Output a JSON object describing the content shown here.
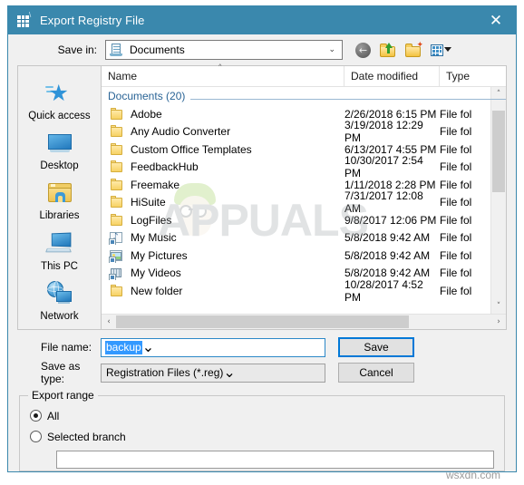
{
  "window": {
    "title": "Export Registry File",
    "icon": "registry-editor-icon",
    "close_label": "✕",
    "titlebar_color": "#3a88ad"
  },
  "toolbar": {
    "savein_label": "Save in:",
    "savein_value": "Documents",
    "savein_icon": "documents-folder-icon",
    "dropdown_caret": "⌄",
    "buttons": [
      {
        "name": "back-button",
        "icon": "back-arrow-icon",
        "glyph": "←"
      },
      {
        "name": "up-one-level-button",
        "icon": "up-folder-icon"
      },
      {
        "name": "create-new-folder-button",
        "icon": "new-folder-icon"
      },
      {
        "name": "views-button",
        "icon": "views-grid-icon",
        "caret": "▾"
      }
    ]
  },
  "places": {
    "items": [
      {
        "label": "Quick access",
        "icon": "quick-access-star-icon"
      },
      {
        "label": "Desktop",
        "icon": "desktop-monitor-icon"
      },
      {
        "label": "Libraries",
        "icon": "libraries-folder-icon"
      },
      {
        "label": "This PC",
        "icon": "this-pc-computer-icon"
      },
      {
        "label": "Network",
        "icon": "network-globe-icon"
      }
    ]
  },
  "file_list": {
    "columns": [
      {
        "key": "name",
        "label": "Name",
        "sorted": true,
        "sort_caret": "˄"
      },
      {
        "key": "date",
        "label": "Date modified"
      },
      {
        "key": "type",
        "label": "Type"
      }
    ],
    "group_header": "Documents (20)",
    "rows": [
      {
        "name": "Adobe",
        "date": "2/26/2018 6:15 PM",
        "type": "File fol",
        "icon": "folder-icon"
      },
      {
        "name": "Any Audio Converter",
        "date": "3/19/2018 12:29 PM",
        "type": "File fol",
        "icon": "folder-icon"
      },
      {
        "name": "Custom Office Templates",
        "date": "6/13/2017 4:55 PM",
        "type": "File fol",
        "icon": "folder-icon"
      },
      {
        "name": "FeedbackHub",
        "date": "10/30/2017 2:54 PM",
        "type": "File fol",
        "icon": "folder-icon"
      },
      {
        "name": "Freemake",
        "date": "1/11/2018 2:28 PM",
        "type": "File fol",
        "icon": "folder-icon"
      },
      {
        "name": "HiSuite",
        "date": "7/31/2017 12:08 AM",
        "type": "File fol",
        "icon": "folder-icon"
      },
      {
        "name": "LogFiles",
        "date": "9/8/2017 12:06 PM",
        "type": "File fol",
        "icon": "folder-icon"
      },
      {
        "name": "My Music",
        "date": "5/8/2018 9:42 AM",
        "type": "File fol",
        "icon": "music-folder-icon"
      },
      {
        "name": "My Pictures",
        "date": "5/8/2018 9:42 AM",
        "type": "File fol",
        "icon": "pictures-folder-icon"
      },
      {
        "name": "My Videos",
        "date": "5/8/2018 9:42 AM",
        "type": "File fol",
        "icon": "videos-folder-icon"
      },
      {
        "name": "New folder",
        "date": "10/28/2017 4:52 PM",
        "type": "File fol",
        "icon": "folder-icon"
      }
    ],
    "scroll_up_glyph": "˄",
    "scroll_down_glyph": "˅",
    "scroll_left_glyph": "‹",
    "scroll_right_glyph": "›"
  },
  "form": {
    "filename_label": "File name:",
    "filename_value": "backup",
    "filename_selected": true,
    "savetype_label": "Save as type:",
    "savetype_value": "Registration Files (*.reg)",
    "save_button": "Save",
    "cancel_button": "Cancel",
    "dropdown_caret": "⌄"
  },
  "export_range": {
    "title": "Export range",
    "options": [
      {
        "label": "All",
        "selected": true
      },
      {
        "label": "Selected branch",
        "selected": false
      }
    ],
    "branch_value": ""
  },
  "watermarks": {
    "center": "APPUALS",
    "corner": "wsxdn.com"
  }
}
